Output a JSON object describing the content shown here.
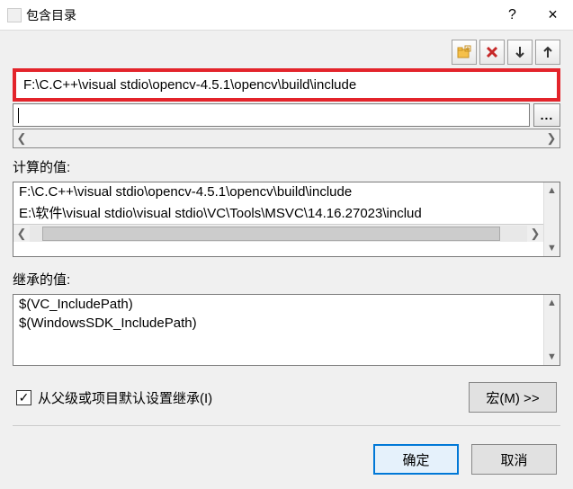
{
  "titlebar": {
    "title": "包含目录",
    "help": "?",
    "close": "×"
  },
  "toolbar": {
    "new_folder": "new-folder",
    "delete": "delete",
    "move_down": "down",
    "move_up": "up"
  },
  "highlighted_path": "F:\\C.C++\\visual stdio\\opencv-4.5.1\\opencv\\build\\include",
  "browse_btn": "...",
  "sections": {
    "computed": {
      "label": "计算的值:",
      "lines": [
        "F:\\C.C++\\visual stdio\\opencv-4.5.1\\opencv\\build\\include",
        "E:\\软件\\visual stdio\\visual stdio\\VC\\Tools\\MSVC\\14.16.27023\\includ"
      ]
    },
    "inherited": {
      "label": "继承的值:",
      "lines": [
        "$(VC_IncludePath)",
        "$(WindowsSDK_IncludePath)"
      ]
    }
  },
  "checkbox": {
    "checked": true,
    "label": "从父级或项目默认设置继承(I)"
  },
  "buttons": {
    "macro": "宏(M) >>",
    "ok": "确定",
    "cancel": "取消"
  }
}
